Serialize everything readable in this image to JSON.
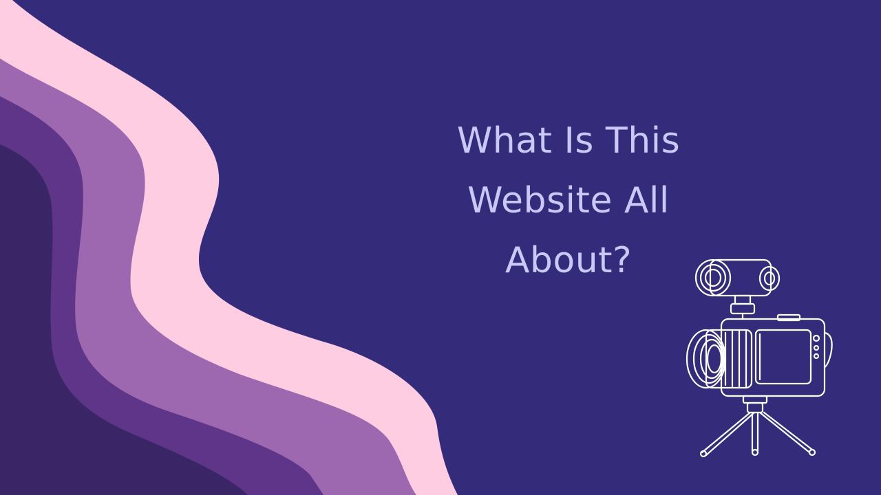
{
  "slide": {
    "title": "What Is This Website All About?",
    "colors": {
      "background": "#342c7a",
      "wave_pink": "#ffcde2",
      "wave_light_purple": "#9d68b0",
      "wave_mid_purple": "#5e3589",
      "wave_dark_purple": "#3a2667",
      "title_text": "#c9c8f8",
      "illustration_stroke": "#ffffff"
    },
    "decorations": {
      "left_waves": "wave-layers",
      "illustration": "video-camera-on-tripod-icon"
    }
  }
}
